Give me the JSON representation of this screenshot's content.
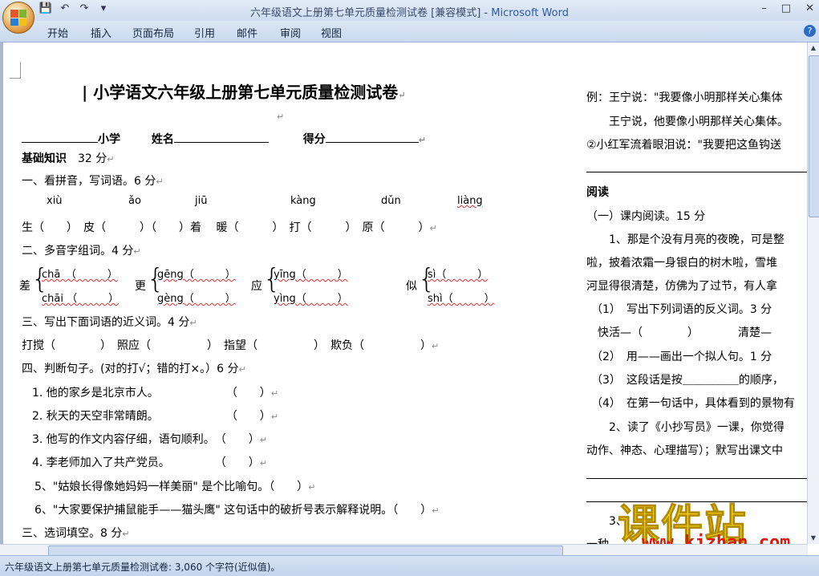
{
  "window": {
    "title": "六年级语文上册第七单元质量检测试卷 [兼容模式] - ",
    "app_name": "Microsoft Word",
    "controls": [
      "–",
      "□",
      "✕"
    ]
  },
  "quick_access": [
    "💾",
    "↶",
    "↷",
    "▾"
  ],
  "ribbon_tabs": [
    "开始",
    "插入",
    "页面布局",
    "引用",
    "邮件",
    "审阅",
    "视图"
  ],
  "status_bar": "六年级语文上册第七单元质量检测试卷: 3,060 个字符(近似值)。",
  "doc": {
    "title": "小学语文六年级上册第七单元质量检测试卷",
    "header_school": "小学",
    "header_name": "姓名",
    "header_score": "得分",
    "basic_section": "基础知识",
    "basic_points": "32 分",
    "q1": "一、看拼音，写词语。6 分",
    "pinyin": [
      "xiù",
      "ǎo",
      "jiū",
      "kàng",
      "dǔn",
      "liàng"
    ],
    "q1_line": "生（　　）　皮（　　　）（　　）着　 暖（　　　）　打（　　　）　原（　　　）",
    "q2": "二、多音字组词。4 分",
    "poly": {
      "c1": "差",
      "c1_a": "chā　（　　　）",
      "c1_b": "chāi （　　　）",
      "c2": "更",
      "c2_a": "gēng（　　　）",
      "c2_b": "gèng（　　　）",
      "c3": "应",
      "c3_a": "yīng（　　　）",
      "c3_b": "yìng（　　　）",
      "c4": "似",
      "c4_a": "sì（　　　）",
      "c4_b": "shì（　　　）"
    },
    "q3": "三、写出下面词语的近义词。4 分",
    "q3_line": " 打搅（　　　　）　照应（　　　　　）　指望（　　　　　）　欺负（　　　　　）",
    "q4": "四、判断句子。(对的打√；错的打×。）6 分",
    "q4_items": [
      "1. 他的家乡是北京市人。　　　　　　　（　　）",
      "2. 秋天的天空非常晴朗。　　　　　　　（　　）",
      "3. 他写的作文内容仔细，语句顺利。　（　　）",
      "4. 李老师加入了共产党员。　　　　　（　　）",
      "5、\"姑娘长得像她妈妈一样美丽\" 是个比喻句。（　　）",
      "6、\"大家要保护捕鼠能手——猫头鹰\" 这句话中的破折号表示解释说明。（　　）"
    ],
    "q5": "三、选词填空。8 分",
    "right": {
      "ex1": "例：王宁说：\"我要像小明那样关心集体",
      "ex2": "　　王宁说，他要像小明那样关心集体。",
      "ex3": "②小红军流着眼泪说：\"我要把这鱼钩送",
      "reading": "阅读",
      "r1": "（一）课内阅读。15 分",
      "r2": "　　1、那是个没有月亮的夜晚，可是整",
      "r3": "啦，披着浓霜一身银白的树木啦，雪堆",
      "r4": "河显得很清楚，仿佛为了过节，有人拿",
      "r5": "（1）　写出下列词语的反义词。3 分",
      "r6": "　快活—（　　　　）　　　　清楚—",
      "r7": "（2）　用——画出一个拟人句。1 分",
      "r8": "（3）　这段话是按＿＿＿＿＿的顺序，",
      "r9": "（4）　在第一句话中，具体看到的景物有",
      "r10": "　　2、读了《小抄写员》一课，你觉得",
      "r11": "动作、神态、心理描写）；默写出课文中",
      "r12": "　　3、",
      "r13": "一种"
    }
  },
  "watermark": {
    "text": "课件站",
    "url": "www.kjzhan.com"
  },
  "colors": {
    "ribbon": "#dbe6f5",
    "status": "#c3d4ec",
    "watermark_yellow": "#f6d20c",
    "watermark_red": "#d71d10"
  }
}
